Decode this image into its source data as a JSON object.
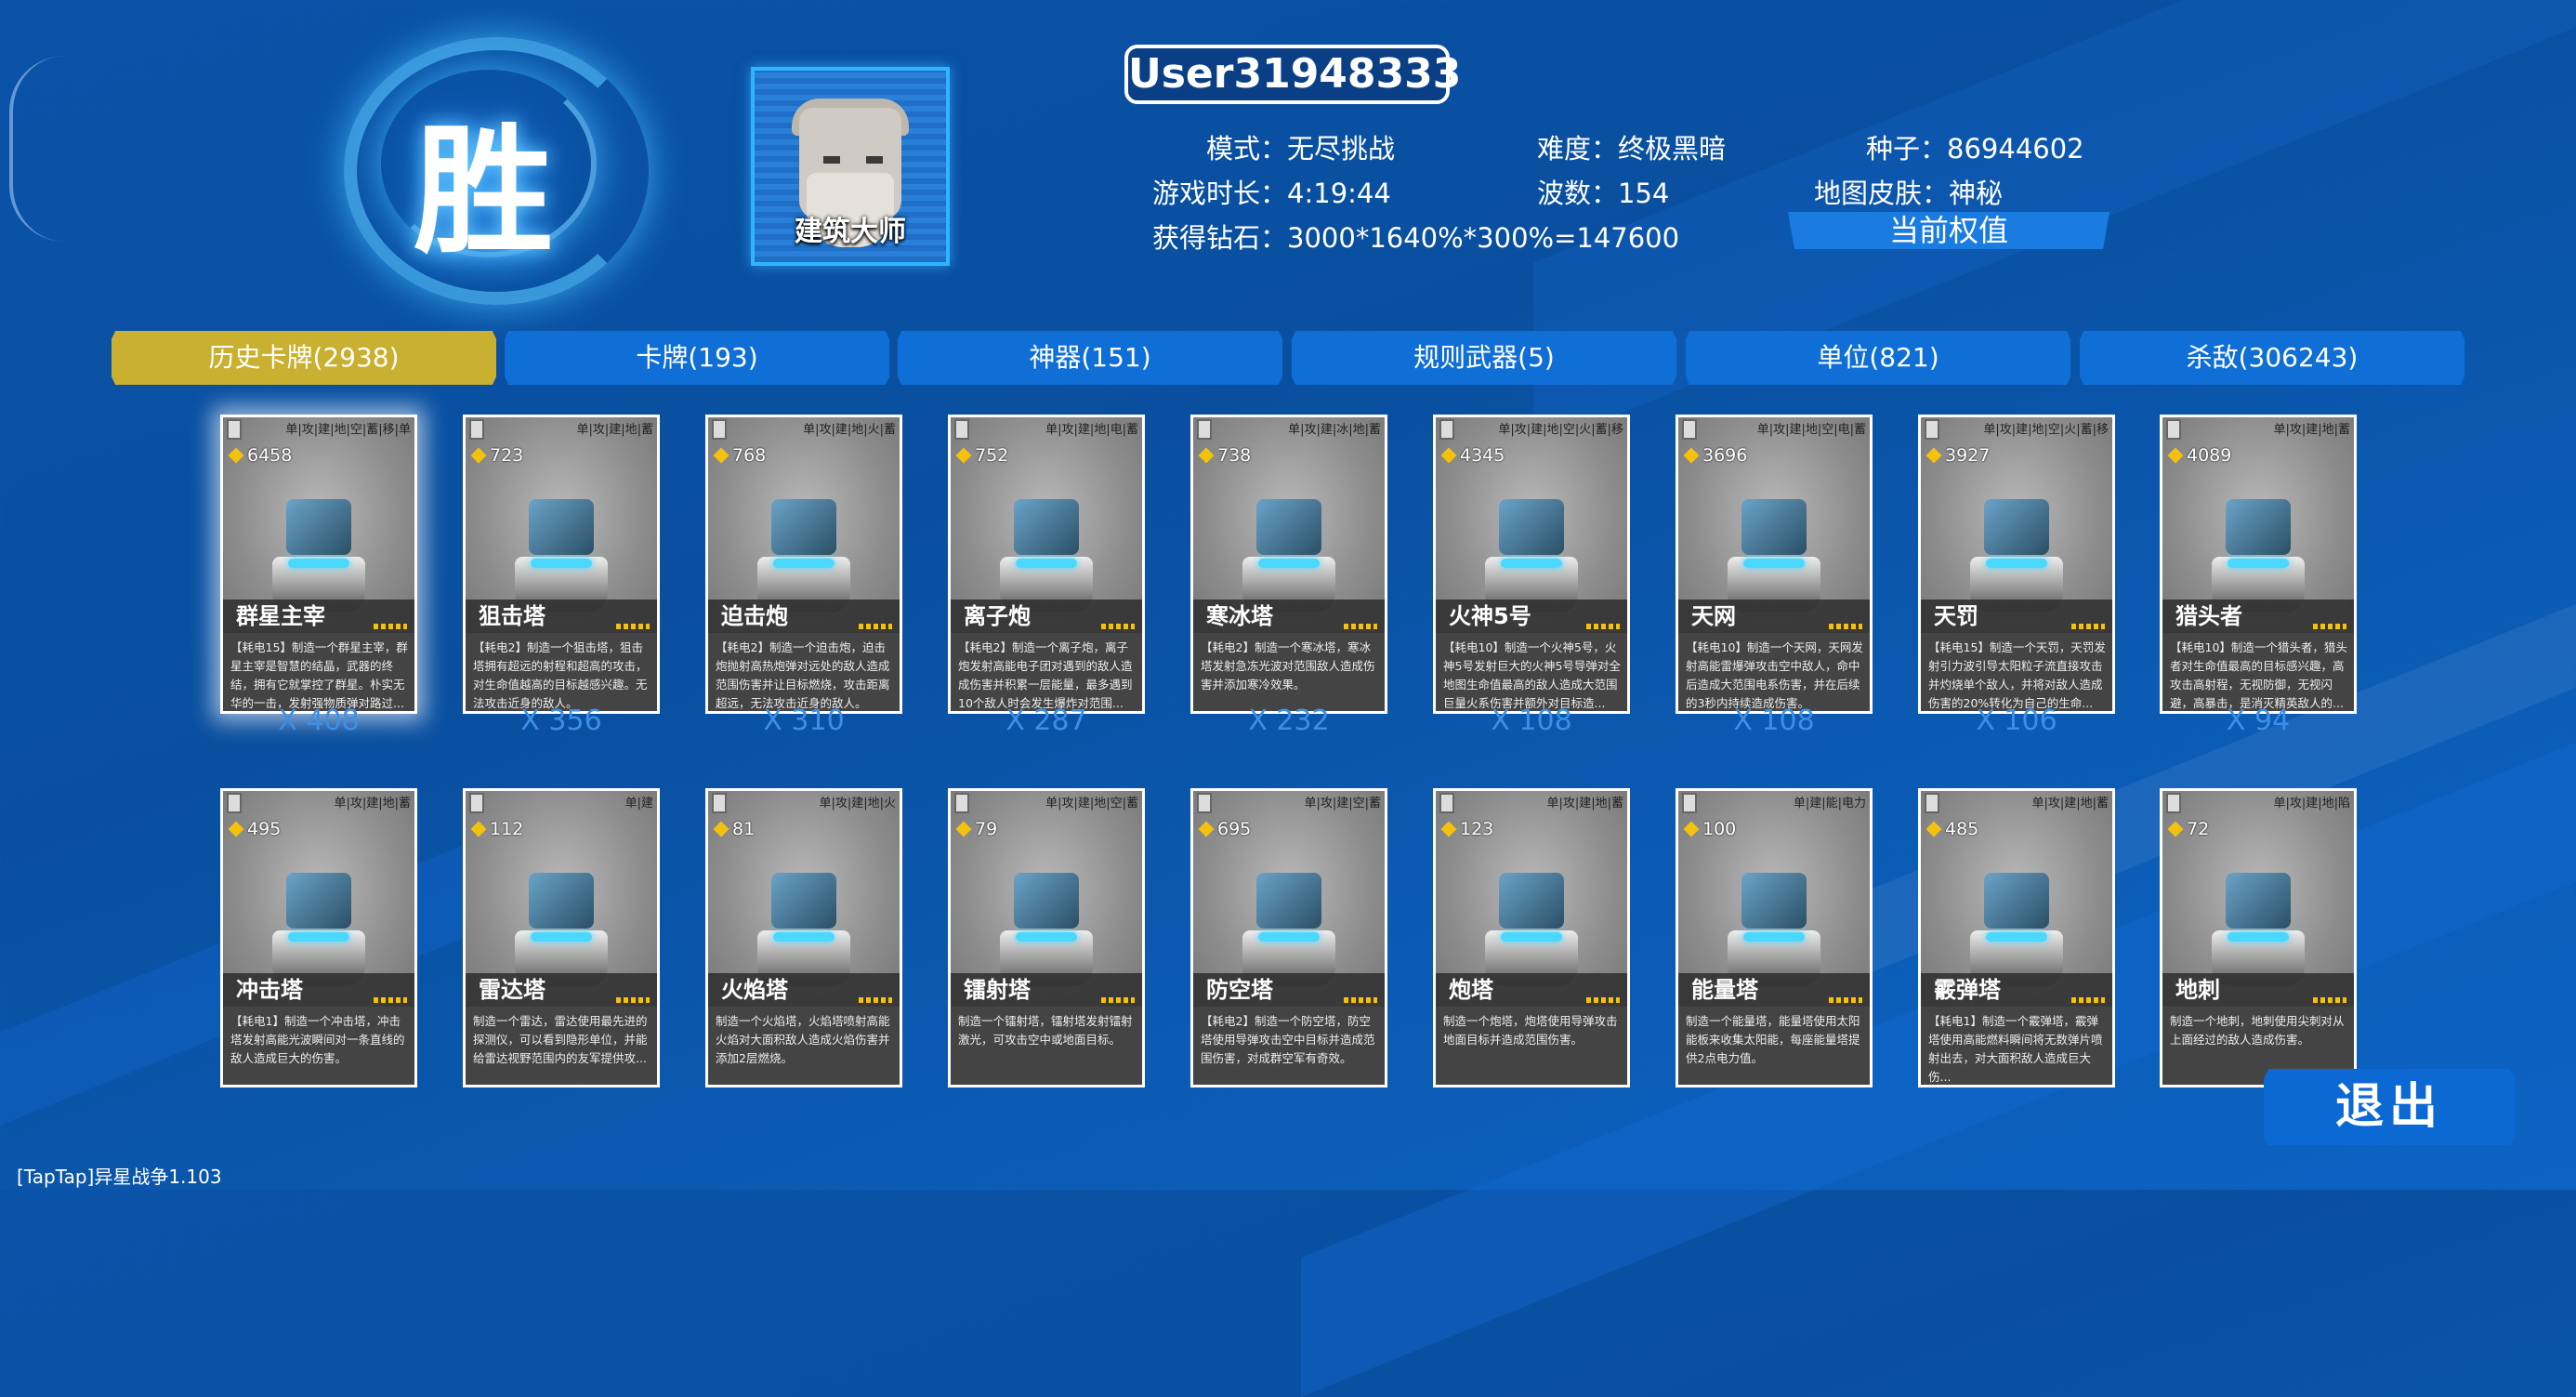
{
  "result_glyph": "胜",
  "avatar_label": "建筑大师",
  "username": "User31948333",
  "info": {
    "mode_label": "模式：",
    "mode": "无尽挑战",
    "difficulty_label": "难度：",
    "difficulty": "终极黑暗",
    "seed_label": "种子：",
    "seed": "86944602",
    "time_label": "游戏时长：",
    "time": "4:19:44",
    "waves_label": "波数：",
    "waves": "154",
    "skin_label": "地图皮肤：",
    "skin": "神秘",
    "diamonds_label": "获得钻石：",
    "diamonds": "3000*1640%*300%=147600"
  },
  "weights_button": "当前权值",
  "tabs": [
    "历史卡牌(2938)",
    "卡牌(193)",
    "神器(151)",
    "规则武器(5)",
    "单位(821)",
    "杀敌(306243)"
  ],
  "row1": [
    {
      "name": "群星主宰",
      "cost": "6458",
      "tags": "单|攻|建|地|空|蓄|移|单",
      "count": "X 408",
      "desc": "【耗电15】制造一个群星主宰，群星主宰是智慧的结晶，武器的终结，拥有它就掌控了群星。朴实无华的一击，发射强物质弹对路过..."
    },
    {
      "name": "狙击塔",
      "cost": "723",
      "tags": "单|攻|建|地|蓄",
      "count": "X 356",
      "desc": "【耗电2】制造一个狙击塔，狙击塔拥有超远的射程和超高的攻击，对生命值越高的目标越感兴趣。无法攻击近身的敌人。"
    },
    {
      "name": "迫击炮",
      "cost": "768",
      "tags": "单|攻|建|地|火|蓄",
      "count": "X 310",
      "desc": "【耗电2】制造一个迫击炮，迫击炮抛射高热炮弹对远处的敌人造成范围伤害并让目标燃烧，攻击距离超远，无法攻击近身的敌人。"
    },
    {
      "name": "离子炮",
      "cost": "752",
      "tags": "单|攻|建|地|电|蓄",
      "count": "X 287",
      "desc": "【耗电2】制造一个离子炮，离子炮发射高能电子团对遇到的敌人造成伤害并积累一层能量，最多遇到10个敌人时会发生爆炸对范围..."
    },
    {
      "name": "寒冰塔",
      "cost": "738",
      "tags": "单|攻|建|冰|地|蓄",
      "count": "X 232",
      "desc": "【耗电2】制造一个寒冰塔，寒冰塔发射急冻光波对范围敌人造成伤害并添加寒冷效果。"
    },
    {
      "name": "火神5号",
      "cost": "4345",
      "tags": "单|攻|建|地|空|火|蓄|移",
      "count": "X 108",
      "desc": "【耗电10】制造一个火神5号，火神5号发射巨大的火神5号导弹对全地图生命值最高的敌人造成大范围巨量火系伤害并额外对目标造..."
    },
    {
      "name": "天网",
      "cost": "3696",
      "tags": "单|攻|建|地|空|电|蓄",
      "count": "X 108",
      "desc": "【耗电10】制造一个天网，天网发射高能雷爆弹攻击空中敌人，命中后造成大范围电系伤害，并在后续的3秒内持续造成伤害。"
    },
    {
      "name": "天罚",
      "cost": "3927",
      "tags": "单|攻|建|地|空|火|蓄|移",
      "count": "X 106",
      "desc": "【耗电15】制造一个天罚，天罚发射引力波引导太阳粒子流直接攻击并灼烧单个敌人，并将对敌人造成伤害的20%转化为自己的生命..."
    },
    {
      "name": "猎头者",
      "cost": "4089",
      "tags": "单|攻|建|地|蓄",
      "count": "X 94",
      "desc": "【耗电10】制造一个猎头者，猎头者对生命值最高的目标感兴趣，高攻击高射程，无视防御，无视闪避，高暴击，是消灭精英敌人的..."
    }
  ],
  "row2": [
    {
      "name": "冲击塔",
      "cost": "495",
      "tags": "单|攻|建|地|蓄",
      "desc": "【耗电1】制造一个冲击塔，冲击塔发射高能光波瞬间对一条直线的敌人造成巨大的伤害。"
    },
    {
      "name": "雷达塔",
      "cost": "112",
      "tags": "单|建",
      "desc": "制造一个雷达，雷达使用最先进的探测仪，可以看到隐形单位，并能给雷达视野范围内的友军提供攻..."
    },
    {
      "name": "火焰塔",
      "cost": "81",
      "tags": "单|攻|建|地|火",
      "desc": "制造一个火焰塔，火焰塔喷射高能火焰对大面积敌人造成火焰伤害并添加2层燃烧。"
    },
    {
      "name": "镭射塔",
      "cost": "79",
      "tags": "单|攻|建|地|空|蓄",
      "desc": "制造一个镭射塔，镭射塔发射镭射激光，可攻击空中或地面目标。"
    },
    {
      "name": "防空塔",
      "cost": "695",
      "tags": "单|攻|建|空|蓄",
      "desc": "【耗电2】制造一个防空塔，防空塔使用导弹攻击空中目标并造成范围伤害，对成群空军有奇效。"
    },
    {
      "name": "炮塔",
      "cost": "123",
      "tags": "单|攻|建|地|蓄",
      "desc": "制造一个炮塔，炮塔使用导弹攻击地面目标并造成范围伤害。"
    },
    {
      "name": "能量塔",
      "cost": "100",
      "tags": "单|建|能|电力",
      "desc": "制造一个能量塔，能量塔使用太阳能板来收集太阳能，每座能量塔提供2点电力值。"
    },
    {
      "name": "霰弹塔",
      "cost": "485",
      "tags": "单|攻|建|地|蓄",
      "desc": "【耗电1】制造一个霰弹塔，霰弹塔使用高能燃料瞬间将无数弹片喷射出去，对大面积敌人造成巨大伤..."
    },
    {
      "name": "地刺",
      "cost": "72",
      "tags": "单|攻|建|地|陷",
      "desc": "制造一个地刺，地刺使用尖刺对从上面经过的敌人造成伤害。"
    }
  ],
  "exit_button": "退出",
  "version": "[TapTap]异星战争1.103",
  "colors": {
    "active_tab": "#c9b030",
    "tab": "#0f6fd6",
    "count": "#3d8fe6"
  }
}
